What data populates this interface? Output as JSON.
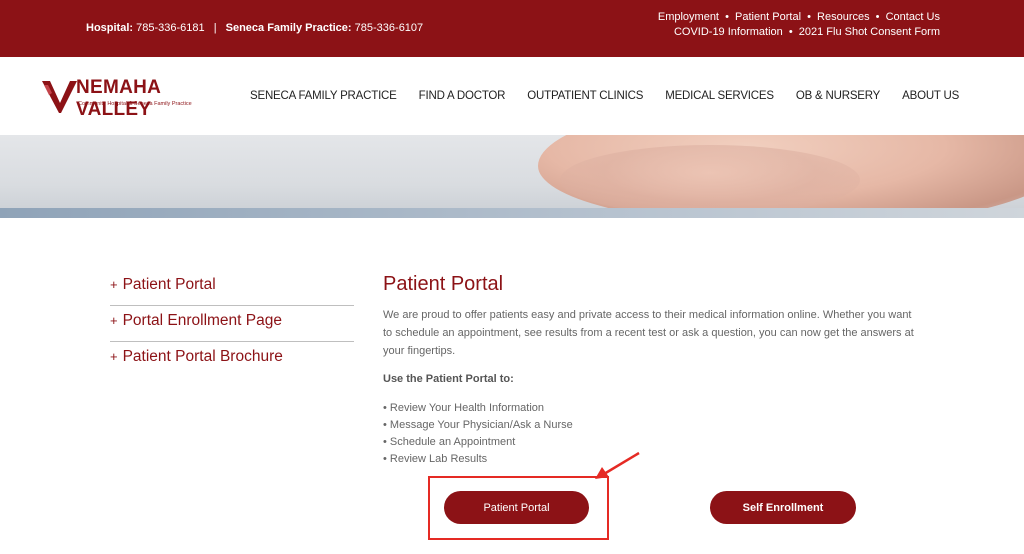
{
  "topbar": {
    "hospital_label": "Hospital:",
    "hospital_phone": "785-336-6181",
    "separator": "|",
    "family_label": "Seneca Family Practice:",
    "family_phone": "785-336-6107",
    "links_row1": [
      "Employment",
      "Patient Portal",
      "Resources",
      "Contact Us"
    ],
    "links_row2": [
      "COVID-19 Information",
      "2021 Flu Shot Consent Form"
    ],
    "bullet": "•"
  },
  "logo": {
    "name": "NEMAHA VALLEY",
    "subtitle": "Community Hospital & Seneca Family Practice"
  },
  "nav": {
    "items": [
      "SENECA FAMILY PRACTICE",
      "FIND A DOCTOR",
      "OUTPATIENT CLINICS",
      "MEDICAL SERVICES",
      "OB & NURSERY",
      "ABOUT US"
    ]
  },
  "sidebar": {
    "plus": "+",
    "items": [
      {
        "label": "Patient Portal"
      },
      {
        "label": "Portal Enrollment Page"
      },
      {
        "label": "Patient Portal Brochure"
      }
    ]
  },
  "main": {
    "title": "Patient Portal",
    "intro": "We are proud to offer patients easy and private access to their medical information online. Whether you want to schedule an appointment, see results from a recent test or ask a question, you can now get the answers at your fingertips.",
    "use_title": "Use the Patient Portal to:",
    "features": [
      "Review Your Health Information",
      "Message Your Physician/Ask a Nurse",
      "Schedule an Appointment",
      "Review Lab Results"
    ]
  },
  "buttons": {
    "portal": "Patient Portal",
    "enroll": "Self Enrollment"
  },
  "colors": {
    "brand": "#8c1216",
    "annotation": "#e52a24"
  }
}
